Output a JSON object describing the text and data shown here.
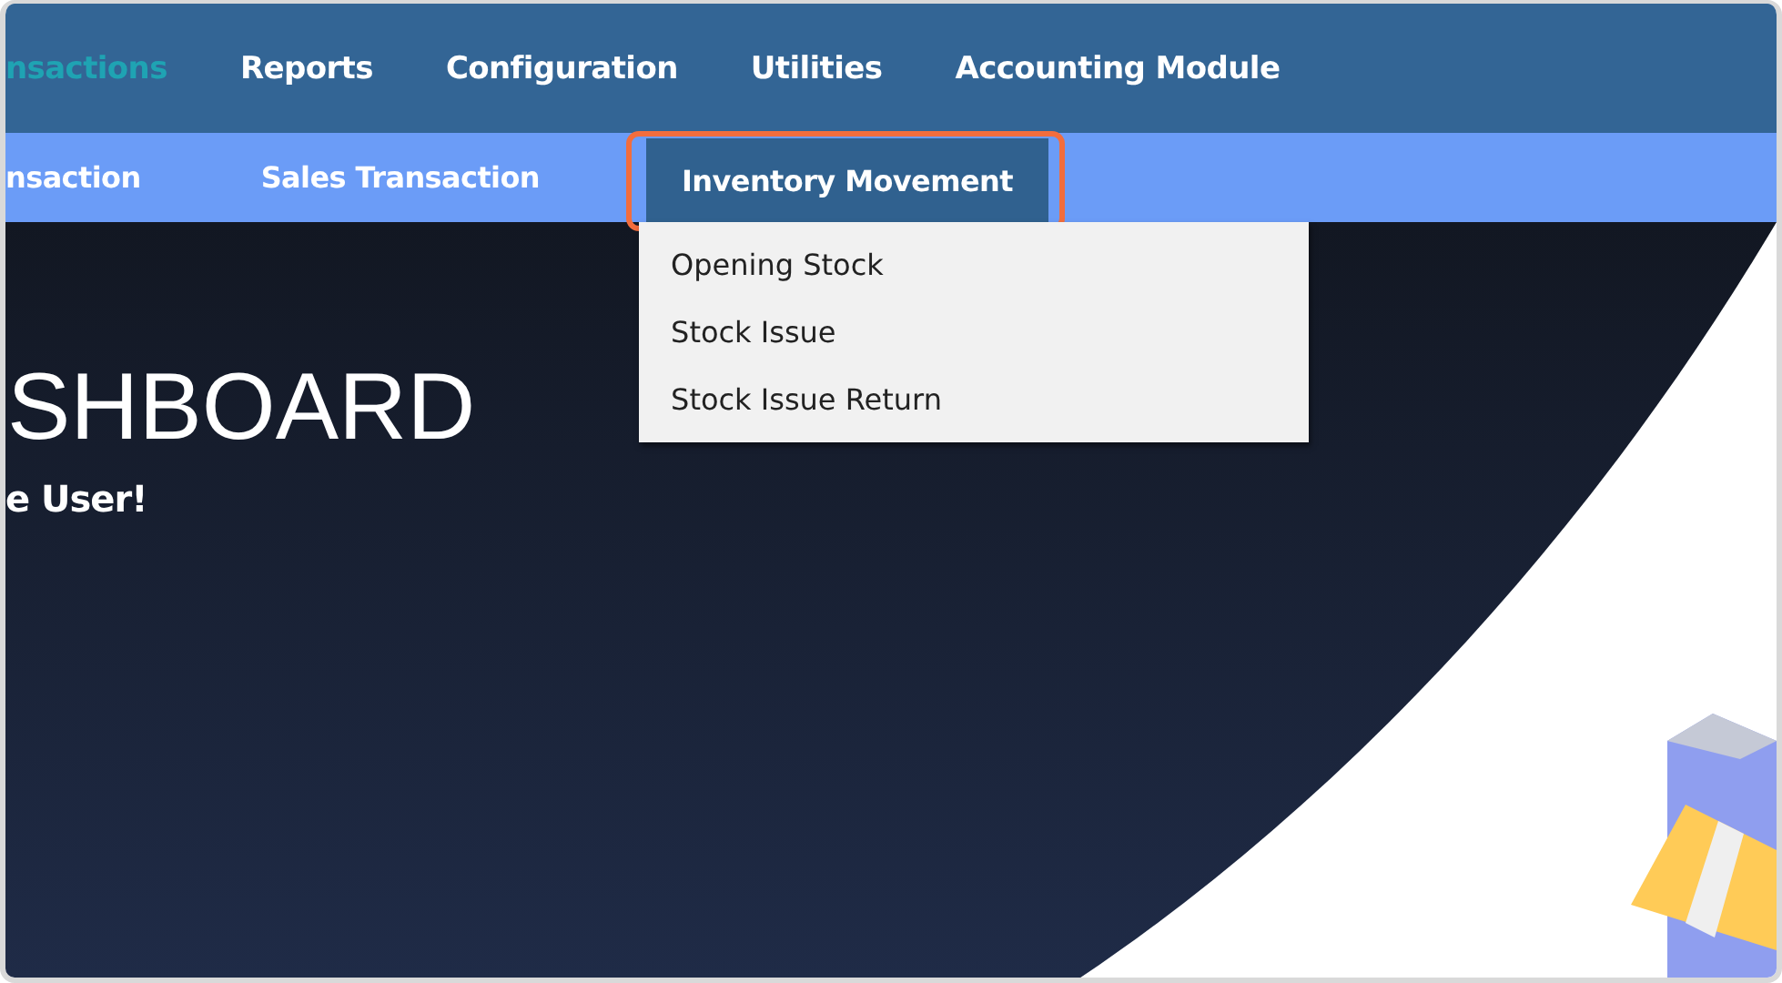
{
  "main_menu": [
    {
      "label": "nsactions",
      "selected": true
    },
    {
      "label": "Reports",
      "selected": false
    },
    {
      "label": "Configuration",
      "selected": false
    },
    {
      "label": "Utilities",
      "selected": false
    },
    {
      "label": "Accounting Module",
      "selected": false
    }
  ],
  "sub_menu": [
    {
      "label": "nsaction",
      "selected": false,
      "highlighted": false
    },
    {
      "label": "Sales Transaction",
      "selected": false,
      "highlighted": false
    },
    {
      "label": "Inventory Movement",
      "selected": true,
      "highlighted": true,
      "dropdown": [
        "Opening Stock",
        "Stock Issue",
        "Stock Issue Return"
      ]
    }
  ],
  "hero": {
    "title": "SHBOARD",
    "subtitle": "e User!"
  }
}
